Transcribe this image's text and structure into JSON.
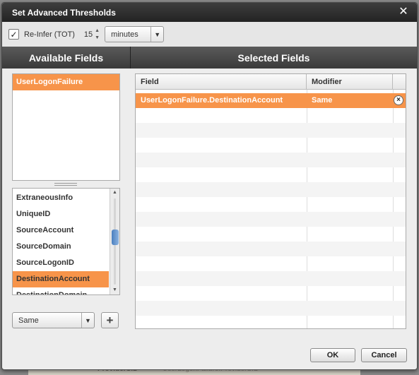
{
  "background": {
    "provider_label": "ProviderSID",
    "value_label": "UserLogonFailure.ProviderSID"
  },
  "dialog": {
    "title": "Set Advanced Thresholds",
    "close_icon": "close-icon"
  },
  "toolbar": {
    "reinfer_checked": true,
    "reinfer_label": "Re-Infer (TOT)",
    "interval_value": "15",
    "unit_value": "minutes"
  },
  "columns": {
    "available": "Available Fields",
    "selected": "Selected Fields"
  },
  "available": {
    "events": [
      "UserLogonFailure"
    ],
    "fields": [
      "ExtraneousInfo",
      "UniqueID",
      "SourceAccount",
      "SourceDomain",
      "SourceLogonID",
      "DestinationAccount",
      "DestinationDomain"
    ],
    "selected_field": "DestinationAccount",
    "modifier_value": "Same"
  },
  "selected_table": {
    "headers": {
      "field": "Field",
      "modifier": "Modifier"
    },
    "rows": [
      {
        "field": "UserLogonFailure.DestinationAccount",
        "modifier": "Same"
      }
    ]
  },
  "buttons": {
    "ok": "OK",
    "cancel": "Cancel"
  },
  "colors": {
    "accent": "#f7944a",
    "titlebar": "#2e2e2e"
  }
}
